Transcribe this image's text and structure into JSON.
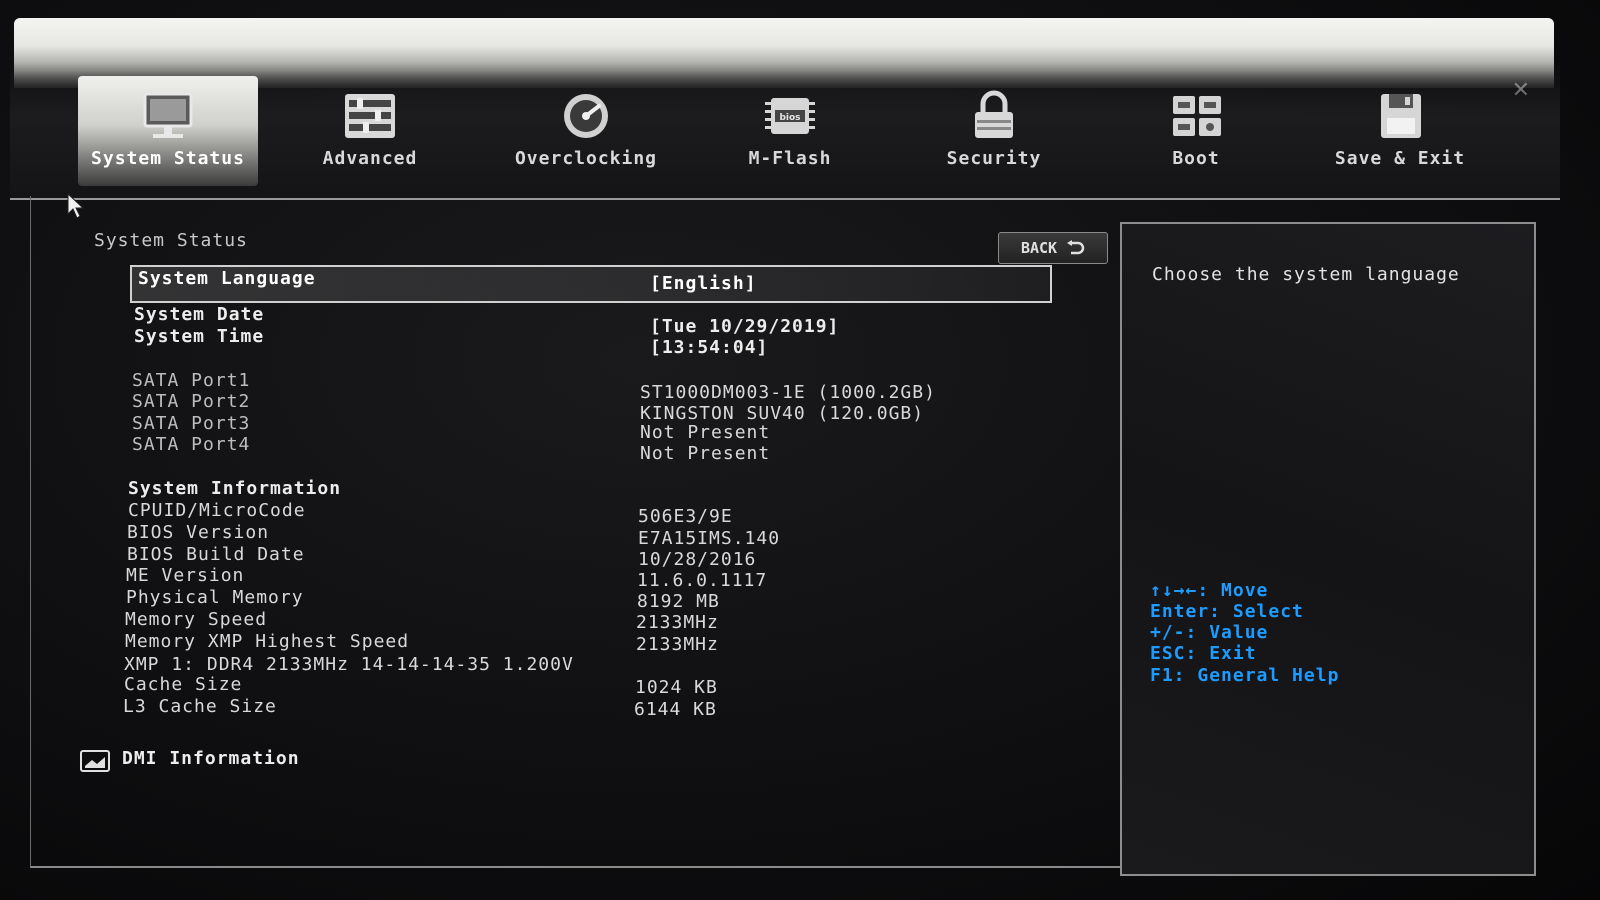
{
  "tabs": [
    {
      "label": "System Status",
      "icon": "monitor-icon",
      "active": true
    },
    {
      "label": "Advanced",
      "icon": "advanced-settings-icon",
      "active": false
    },
    {
      "label": "Overclocking",
      "icon": "gauge-icon",
      "active": false
    },
    {
      "label": "M-Flash",
      "icon": "bios-chip-icon",
      "active": false
    },
    {
      "label": "Security",
      "icon": "lock-icon",
      "active": false
    },
    {
      "label": "Boot",
      "icon": "boot-icon",
      "active": false
    },
    {
      "label": "Save & Exit",
      "icon": "floppy-disk-icon",
      "active": false
    }
  ],
  "main": {
    "section_title": "System Status",
    "back_label": "BACK",
    "language": {
      "label": "System Language",
      "value": "[English]"
    },
    "date": {
      "label": "System Date",
      "value": "[Tue 10/29/2019]"
    },
    "time": {
      "label": "System Time",
      "value": "[13:54:04]"
    },
    "sata": [
      {
        "label": "SATA Port1",
        "value": "ST1000DM003-1E (1000.2GB)"
      },
      {
        "label": "SATA Port2",
        "value": "KINGSTON SUV40 (120.0GB)"
      },
      {
        "label": "SATA Port3",
        "value": "Not Present"
      },
      {
        "label": "SATA Port4",
        "value": "Not Present"
      }
    ],
    "system_info_title": "System Information",
    "system_info": [
      {
        "label": "CPUID/MicroCode",
        "value": "506E3/9E"
      },
      {
        "label": "BIOS Version",
        "value": "E7A15IMS.140"
      },
      {
        "label": "BIOS Build Date",
        "value": "10/28/2016"
      },
      {
        "label": "ME Version",
        "value": "11.6.0.1117"
      },
      {
        "label": "Physical Memory",
        "value": "8192 MB"
      },
      {
        "label": "Memory Speed",
        "value": "2133MHz"
      },
      {
        "label": "Memory XMP Highest Speed",
        "value": "2133MHz"
      },
      {
        "label": "XMP 1: DDR4 2133MHz 14-14-14-35 1.200V",
        "value": ""
      },
      {
        "label": "Cache Size",
        "value": "1024 KB"
      },
      {
        "label": "L3 Cache Size",
        "value": "6144 KB"
      }
    ],
    "dmi_label": "DMI Information"
  },
  "help": {
    "description": "Choose the system language",
    "keys": [
      {
        "key": "↑↓→←:",
        "action": "Move"
      },
      {
        "key": "Enter:",
        "action": "Select"
      },
      {
        "key": "+/-:",
        "action": "Value"
      },
      {
        "key": "ESC:",
        "action": "Exit"
      },
      {
        "key": "F1:",
        "action": "General Help"
      }
    ]
  },
  "colors": {
    "help_key": "#1e9bff",
    "text": "#d9d9d9"
  }
}
